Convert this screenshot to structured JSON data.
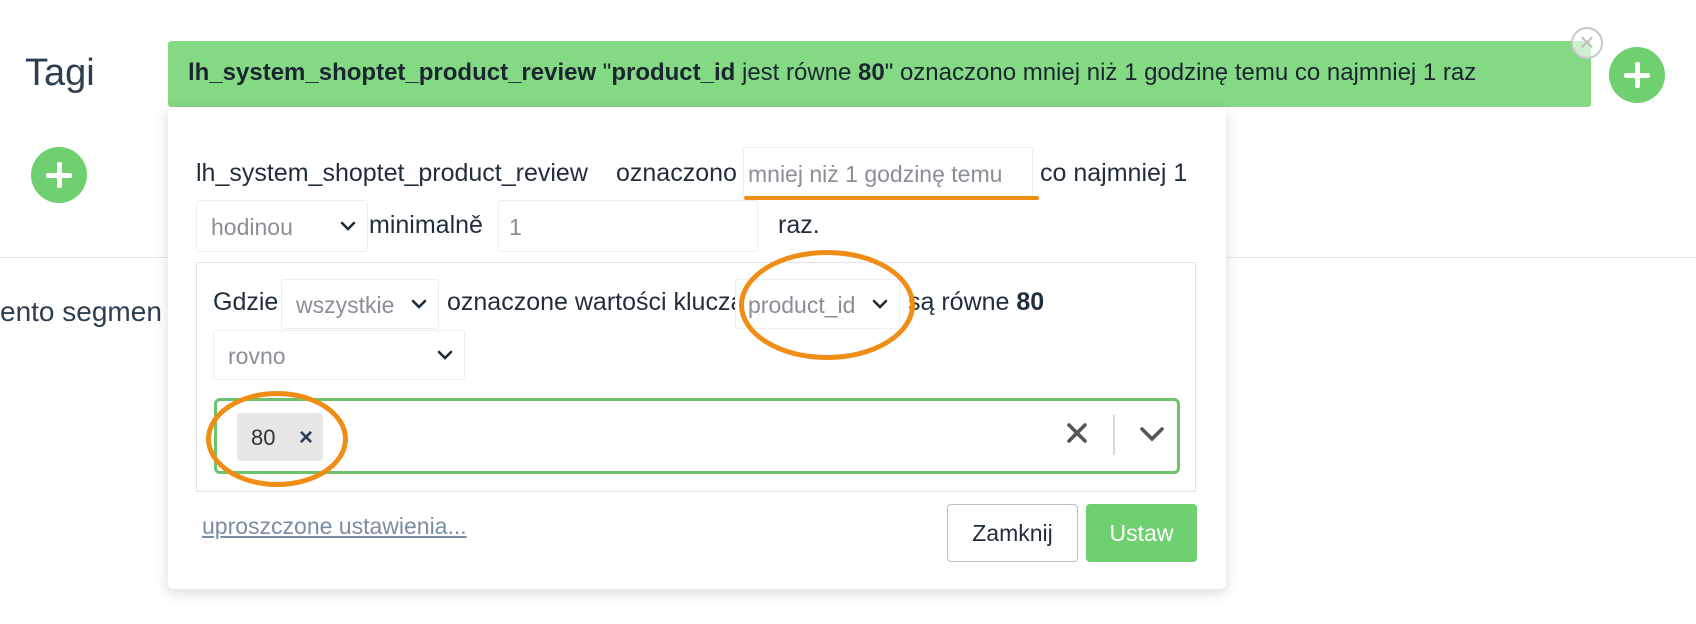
{
  "page": {
    "title": "Tagi",
    "background_text": "ento segmen"
  },
  "banner": {
    "tag_name": "lh_system_shoptet_product_review",
    "quote_open": " \"",
    "key": "product_id",
    "equals_text": " jest równe ",
    "value": "80",
    "quote_close": "\"",
    "suffix": " oznaczono mniej niż 1 godzinę temu co najmniej 1 raz"
  },
  "editor": {
    "tag_name": "lh_system_shoptet_product_review",
    "marked_label": "oznaczono",
    "time_value": "mniej niż 1 godzinę temu",
    "at_least_label": "co najmniej 1",
    "period_select": "hodinou",
    "minimum_label": "minimalně",
    "count_value": "1",
    "times_label": "raz."
  },
  "filter": {
    "where_label": "Gdzie",
    "quantifier_select": "wszystkie",
    "key_values_label": "oznaczone wartości klucza",
    "key_select": "product_id",
    "equal_prefix": "są równe ",
    "equal_value": "80",
    "operator_select": "rovno",
    "tags": [
      {
        "label": "80"
      }
    ]
  },
  "footer": {
    "simplified_link": "uproszczone ustawienia...",
    "close_button": "Zamknij",
    "set_button": "Ustaw"
  },
  "colors": {
    "accent_green": "#6fd06f",
    "banner_green": "#84d984",
    "highlight_orange": "#ef8d14"
  }
}
